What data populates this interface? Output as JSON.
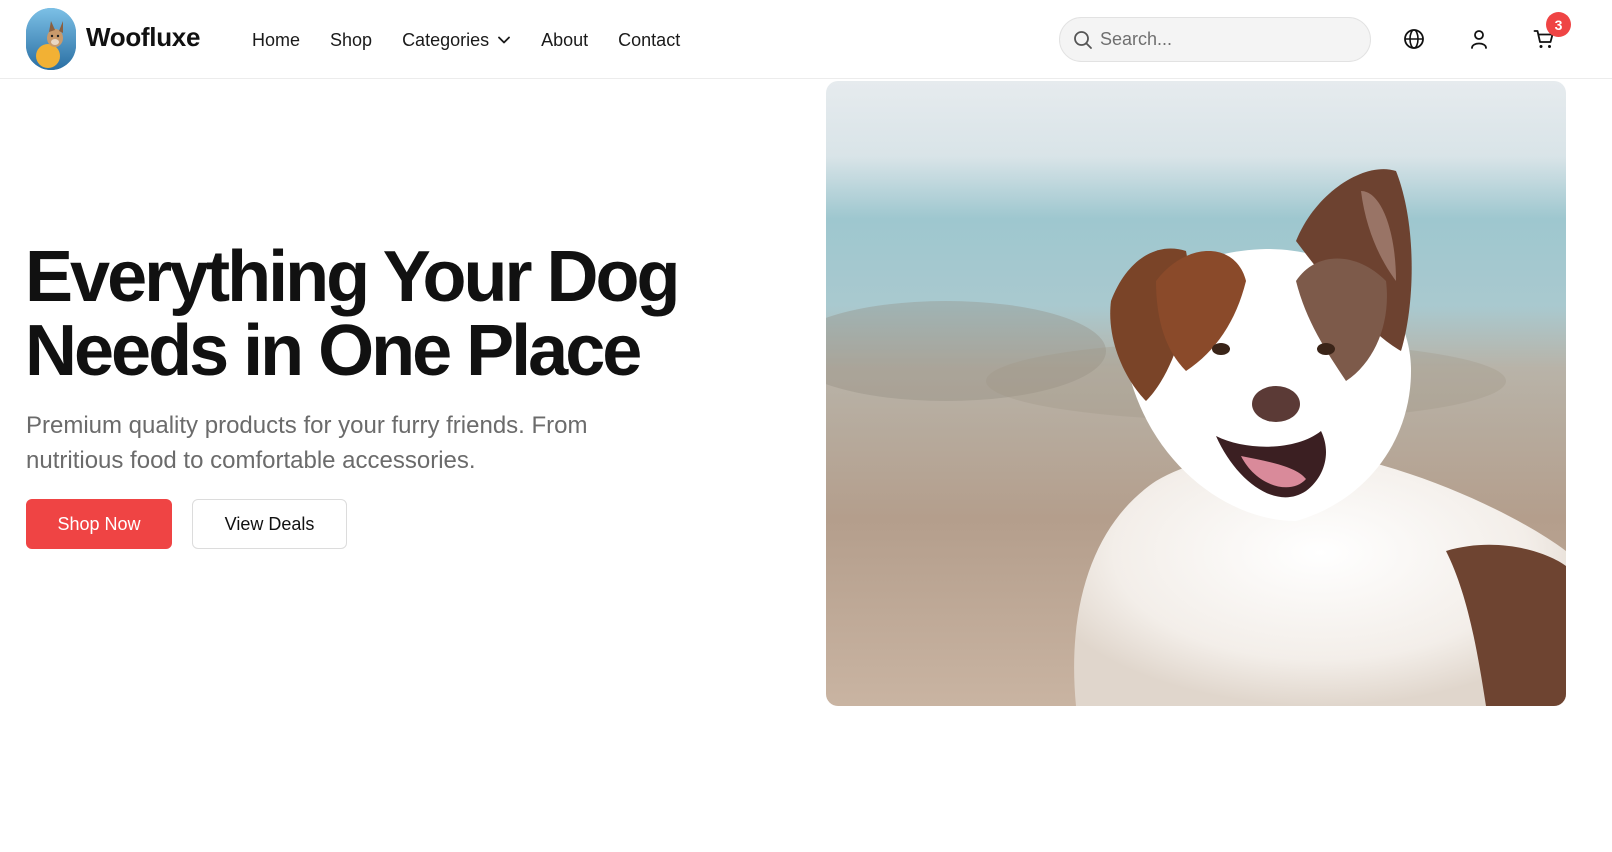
{
  "brand": {
    "name": "Woofluxe",
    "logo_icon": "dog-logo-icon"
  },
  "nav": {
    "items": [
      {
        "label": "Home"
      },
      {
        "label": "Shop"
      },
      {
        "label": "Categories",
        "has_dropdown": true
      },
      {
        "label": "About"
      },
      {
        "label": "Contact"
      }
    ]
  },
  "search": {
    "placeholder": "Search...",
    "value": ""
  },
  "actions": {
    "language_icon": "globe-icon",
    "account_icon": "user-icon",
    "cart_icon": "shopping-cart-icon",
    "cart_count": "3"
  },
  "hero": {
    "title_line1": "Everything Your Dog",
    "title_line2": "Needs in One Place",
    "subtitle": "Premium quality products for your furry friends. From nutritious food to comfortable accessories.",
    "primary_button": "Shop Now",
    "secondary_button": "View Deals",
    "image_subject": "dog-photo"
  },
  "colors": {
    "accent": "#ef4444",
    "text": "#111111",
    "muted": "#6b6b6b",
    "border": "#e2e2e2"
  }
}
